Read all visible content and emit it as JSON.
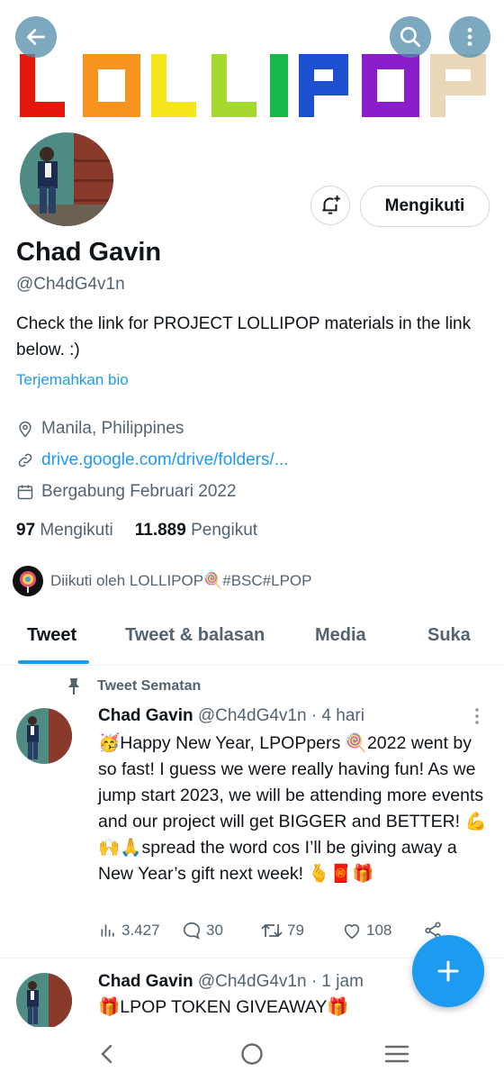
{
  "banner": {
    "letters_text": "LOLLIPOP",
    "letter_colors": [
      "#e3170a",
      "#f7941d",
      "#f5e61b",
      "#a6d930",
      "#19b84a",
      "#1f4fd1",
      "#8a1fc9",
      "#ead7b8"
    ]
  },
  "profile": {
    "name": "Chad Gavin",
    "handle": "@Ch4dG4v1n",
    "bio": "Check the link for PROJECT LOLLIPOP materials in the link below. :)",
    "translate_label": "Terjemahkan bio",
    "location": "Manila, Philippines",
    "link": "drive.google.com/drive/folders/...",
    "joined": "Bergabung Februari 2022",
    "following_count": "97",
    "following_label": "Mengikuti",
    "followers_count": "11.889",
    "followers_label": "Pengikut",
    "followed_by": "Diikuti oleh LOLLIPOP🍭#BSC#LPOP",
    "follow_button_label": "Mengikuti"
  },
  "tabs": [
    "Tweet",
    "Tweet & balasan",
    "Media",
    "Suka"
  ],
  "tweets": [
    {
      "pinned_label": "Tweet Sematan",
      "name": "Chad Gavin",
      "handle_time": "@Ch4dG4v1n · 4 hari",
      "text": "🥳Happy New Year, LPOPpers 🍭2022 went by so fast! I guess we were really having fun! As we jump start 2023, we will be attending more events and our project will get BIGGER and BETTER! 💪🙌🙏spread the word cos I’ll be giving away a New Year’s gift next week! 🫰🧧🎁",
      "views": "3.427",
      "replies": "30",
      "retweets": "79",
      "likes": "108"
    },
    {
      "name": "Chad Gavin",
      "handle_time": "@Ch4dG4v1n · 1 jam",
      "text": "🎁LPOP TOKEN GIVEAWAY🎁"
    }
  ],
  "colors": {
    "accent": "#1d9bf0",
    "secondary_text": "#536471",
    "primary_text": "#0f1419"
  }
}
